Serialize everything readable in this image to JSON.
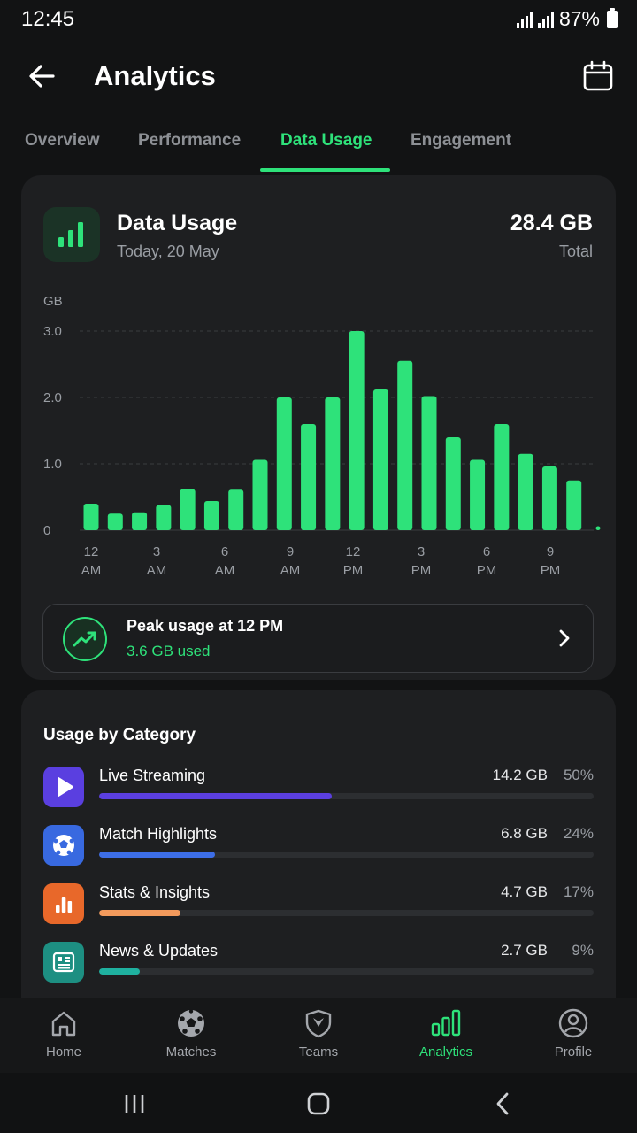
{
  "status_bar": {
    "time": "12:45",
    "battery": "87%"
  },
  "header": {
    "title": "Analytics"
  },
  "tabs": [
    {
      "label": "Overview"
    },
    {
      "label": "Performance"
    },
    {
      "label": "Data Usage"
    },
    {
      "label": "Engagement"
    }
  ],
  "active_tab": "Data Usage",
  "colors": {
    "accent": "#2ee27a",
    "card": "#1e1f21",
    "background": "#121314"
  },
  "data_usage": {
    "title": "Data Usage",
    "date": "Today, 20 May",
    "total": "28.4 GB",
    "total_label": "Total"
  },
  "chart_data": {
    "type": "bar",
    "ylabel": "GB",
    "ylim": [
      0,
      3.0
    ],
    "yticks": [
      "3.0",
      "2.0",
      "1.0",
      "0"
    ],
    "grid": true,
    "xtick_labels": [
      {
        "line1": "12",
        "line2": "AM"
      },
      {
        "line1": "3",
        "line2": "AM"
      },
      {
        "line1": "6",
        "line2": "AM"
      },
      {
        "line1": "9",
        "line2": "AM"
      },
      {
        "line1": "12",
        "line2": "PM"
      },
      {
        "line1": "3",
        "line2": "PM"
      },
      {
        "line1": "6",
        "line2": "PM"
      },
      {
        "line1": "9",
        "line2": "PM"
      }
    ],
    "values": [
      0.4,
      0.25,
      0.27,
      0.38,
      0.62,
      0.44,
      0.61,
      1.06,
      2.0,
      1.6,
      2.0,
      3.0,
      2.12,
      2.55,
      2.02,
      1.4,
      1.06,
      1.6,
      1.15,
      0.96,
      0.75,
      0.06
    ],
    "color": "#2ee27a"
  },
  "peak": {
    "title": "Peak usage at 12 PM",
    "subtitle": "3.6 GB used"
  },
  "categories": {
    "heading": "Usage by Category",
    "items": [
      {
        "name": "Live Streaming",
        "gb": "14.2 GB",
        "pct": "50%",
        "fraction": 0.47,
        "color": "#5b3fe0",
        "icon_color": "#5a3fe0",
        "icon": "play-icon"
      },
      {
        "name": "Match Highlights",
        "gb": "6.8 GB",
        "pct": "24%",
        "fraction": 0.235,
        "color": "#3d6ee8",
        "icon_color": "#3869e0",
        "icon": "soccer-ball-icon"
      },
      {
        "name": "Stats & Insights",
        "gb": "4.7 GB",
        "pct": "17%",
        "fraction": 0.165,
        "color": "#f39a5c",
        "icon_color": "#e8682a",
        "icon": "bar-chart-icon"
      },
      {
        "name": "News & Updates",
        "gb": "2.7 GB",
        "pct": "9%",
        "fraction": 0.082,
        "color": "#1fb1a0",
        "icon_color": "#1d8f82",
        "icon": "newspaper-icon"
      }
    ]
  },
  "bottom_nav": [
    {
      "label": "Home",
      "icon": "home-icon"
    },
    {
      "label": "Matches",
      "icon": "soccer-ball-icon"
    },
    {
      "label": "Teams",
      "icon": "shield-icon"
    },
    {
      "label": "Analytics",
      "icon": "analytics-icon"
    },
    {
      "label": "Profile",
      "icon": "profile-icon"
    }
  ],
  "active_nav": "Analytics"
}
